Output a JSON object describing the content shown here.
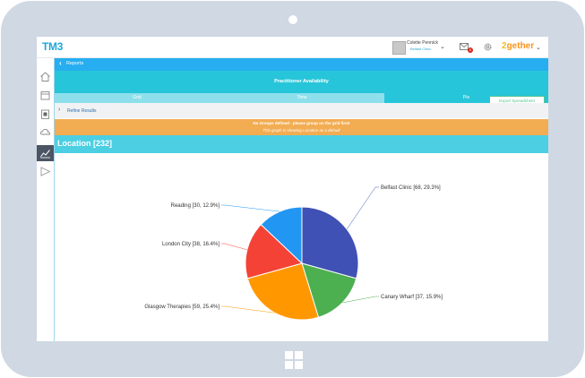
{
  "header": {
    "logo": "TM3",
    "user_name": "Colette Pennick",
    "user_clinic": "Belfast Clinic",
    "mail_count": "0",
    "brand_prefix": "2",
    "brand_rest": "gether"
  },
  "breadcrumb": {
    "label": "Reports"
  },
  "report": {
    "title": "Practitioner Availability",
    "tabs": [
      {
        "label": "Grid"
      },
      {
        "label": "Time"
      },
      {
        "label": "Pie"
      }
    ],
    "active_tab": "Pie",
    "export_label": "Export Spreadsheet",
    "refine_label": "Refine Results",
    "warning_line1": "No Groups defined - please group on the grid first!",
    "warning_line2": "This graph is showing Location as a default",
    "section_title": "Location [232]"
  },
  "colors": {
    "accent_blue": "#26aef0",
    "teal": "#27c5d9",
    "warning": "#f2ac52"
  },
  "chart_data": {
    "type": "pie",
    "title": "Location [232]",
    "slices": [
      {
        "name": "Belfast Clinic",
        "value": 68,
        "percent": 29.3,
        "label": "Belfast Clinic [68, 29.3%]",
        "color": "#3f51b5"
      },
      {
        "name": "Canary Wharf",
        "value": 37,
        "percent": 15.9,
        "label": "Canary Wharf [37, 15.9%]",
        "color": "#4caf50"
      },
      {
        "name": "Glasgow Therapies",
        "value": 59,
        "percent": 25.4,
        "label": "Glasgow Therapies [59, 25.4%]",
        "color": "#ff9800"
      },
      {
        "name": "London City",
        "value": 38,
        "percent": 16.4,
        "label": "London City [38, 16.4%]",
        "color": "#f44336"
      },
      {
        "name": "Reading",
        "value": 30,
        "percent": 12.9,
        "label": "Reading [30, 12.9%]",
        "color": "#2196f3"
      }
    ]
  }
}
